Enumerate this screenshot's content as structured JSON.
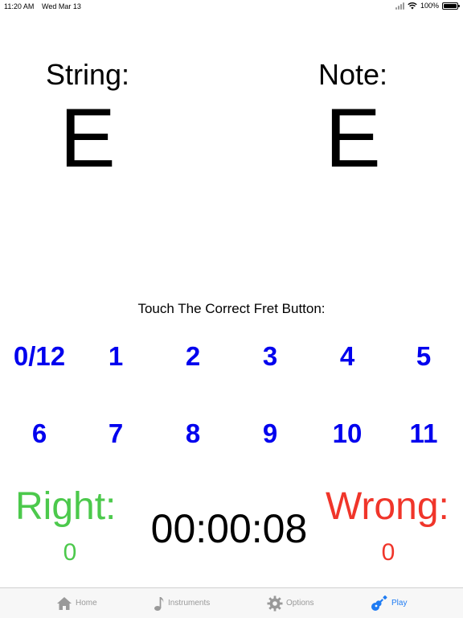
{
  "status_bar": {
    "time": "11:20 AM",
    "date": "Wed Mar 13",
    "battery": "100%",
    "icons": [
      "signal-icon",
      "wifi-icon",
      "battery-icon"
    ]
  },
  "string_panel": {
    "label": "String:",
    "value": "E"
  },
  "note_panel": {
    "label": "Note:",
    "value": "E"
  },
  "instruction": "Touch The Correct Fret Button:",
  "frets": [
    "0/12",
    "1",
    "2",
    "3",
    "4",
    "5",
    "6",
    "7",
    "8",
    "9",
    "10",
    "11"
  ],
  "scores": {
    "right_label": "Right:",
    "right_value": "0",
    "wrong_label": "Wrong:",
    "wrong_value": "0",
    "timer": "00:00:08"
  },
  "tabs": [
    {
      "label": "Home",
      "icon": "home-icon",
      "selected": false
    },
    {
      "label": "Instruments",
      "icon": "music-note-icon",
      "selected": false
    },
    {
      "label": "Options",
      "icon": "gear-icon",
      "selected": false
    },
    {
      "label": "Play",
      "icon": "guitar-icon",
      "selected": true
    }
  ],
  "colors": {
    "fret_text": "#0000ee",
    "right": "#4cc94c",
    "wrong": "#f0352a",
    "tab_selected": "#1f7cf3",
    "tab_unselected": "#999999"
  }
}
